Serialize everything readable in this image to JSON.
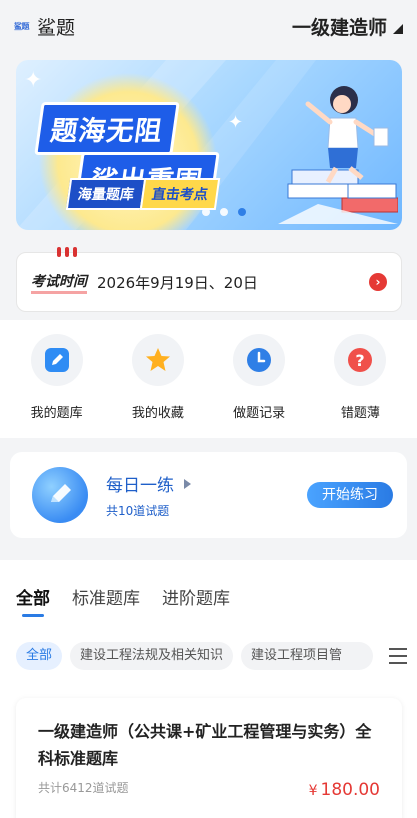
{
  "header": {
    "logo_text": "鲨题",
    "brand": "鲨题",
    "exam": "一级建造师"
  },
  "banner": {
    "title_line1": "题海无阻",
    "title_line2": "鲨出重围",
    "tag_left": "海量题库",
    "tag_right": "直击考点",
    "slide_count": 3,
    "active_slide": 3
  },
  "exam_time": {
    "label": "考试时间",
    "value": "2026年9月19日、20日"
  },
  "quick_nav": [
    {
      "label": "我的题库",
      "icon": "edit-icon",
      "color": "#2f8cf4"
    },
    {
      "label": "我的收藏",
      "icon": "star-icon",
      "color": "#ffb020"
    },
    {
      "label": "做题记录",
      "icon": "clock-icon",
      "color": "#2f7fe6"
    },
    {
      "label": "错题薄",
      "icon": "question-icon",
      "color": "#f0504a"
    }
  ],
  "daily": {
    "title": "每日一练",
    "subtitle": "共10道试题",
    "button": "开始练习"
  },
  "tabs": [
    "全部",
    "标准题库",
    "进阶题库"
  ],
  "active_tab": "全部",
  "chips": [
    "全部",
    "建设工程法规及相关知识",
    "建设工程项目管"
  ],
  "product": {
    "title": "一级建造师（公共课+矿业工程管理与实务）全科标准题库",
    "meta": "共计6412道试题",
    "currency": "¥",
    "price": "180.00"
  },
  "colors": {
    "accent": "#2a7be4",
    "price": "#e53935"
  }
}
